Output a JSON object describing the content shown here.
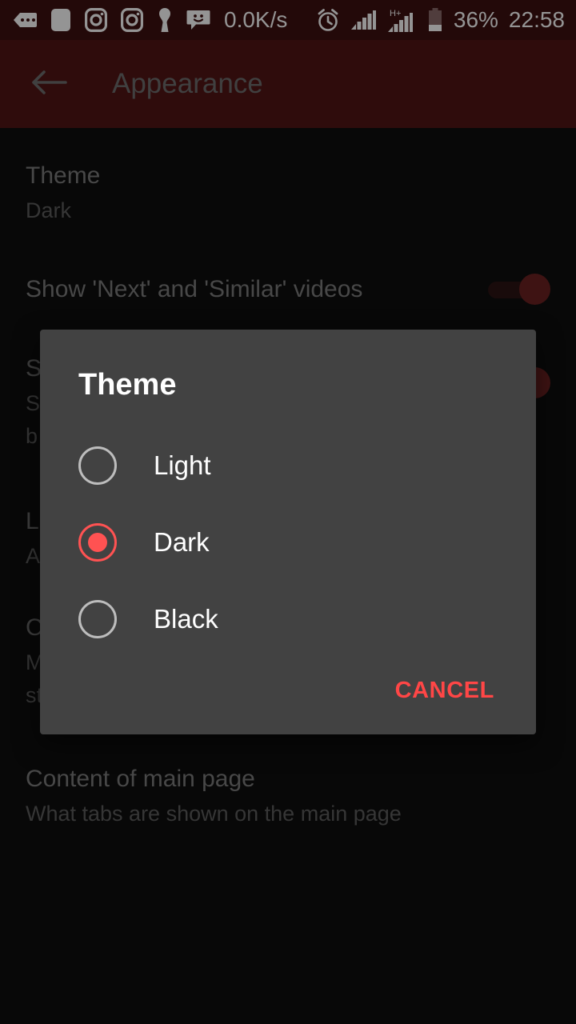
{
  "statusbar": {
    "icons_left": [
      "messages-dots-icon",
      "square-app-icon",
      "instagram-icon",
      "instagram-icon",
      "keyhole-icon",
      "chat-smiley-icon"
    ],
    "network_speed": "0.0K/s",
    "icons_right": [
      "alarm-clock-icon",
      "signal-bars-icon",
      "hplus-signal-icon",
      "battery-icon"
    ],
    "battery": "36%",
    "time": "22:58",
    "background": "#3d1010"
  },
  "appbar": {
    "back_icon": "arrow-left-icon",
    "title": "Appearance",
    "background": "#511515",
    "title_color": "#6f6f6f"
  },
  "settings": {
    "items": [
      {
        "title": "Theme",
        "subtitle": "Dark",
        "control": "none"
      },
      {
        "title": "Show 'Next' and 'Similar' videos",
        "subtitle": "",
        "control": "switch-on"
      },
      {
        "title": "S",
        "subtitle": "S",
        "subtitle2": "b",
        "control": "switch-on"
      },
      {
        "title": "L",
        "subtitle": "A",
        "control": "none"
      },
      {
        "title": "C",
        "subtitle": "M",
        "subtitle2": "st",
        "control": "none"
      },
      {
        "title": "Content of main page",
        "subtitle": "What tabs are shown on the main page",
        "control": "none"
      }
    ]
  },
  "dialog": {
    "title": "Theme",
    "background": "#424242",
    "accent": "#ff5252",
    "options": [
      {
        "label": "Light",
        "selected": false
      },
      {
        "label": "Dark",
        "selected": true
      },
      {
        "label": "Black",
        "selected": false
      }
    ],
    "cancel_label": "CANCEL",
    "cancel_color": "#ff4646"
  }
}
